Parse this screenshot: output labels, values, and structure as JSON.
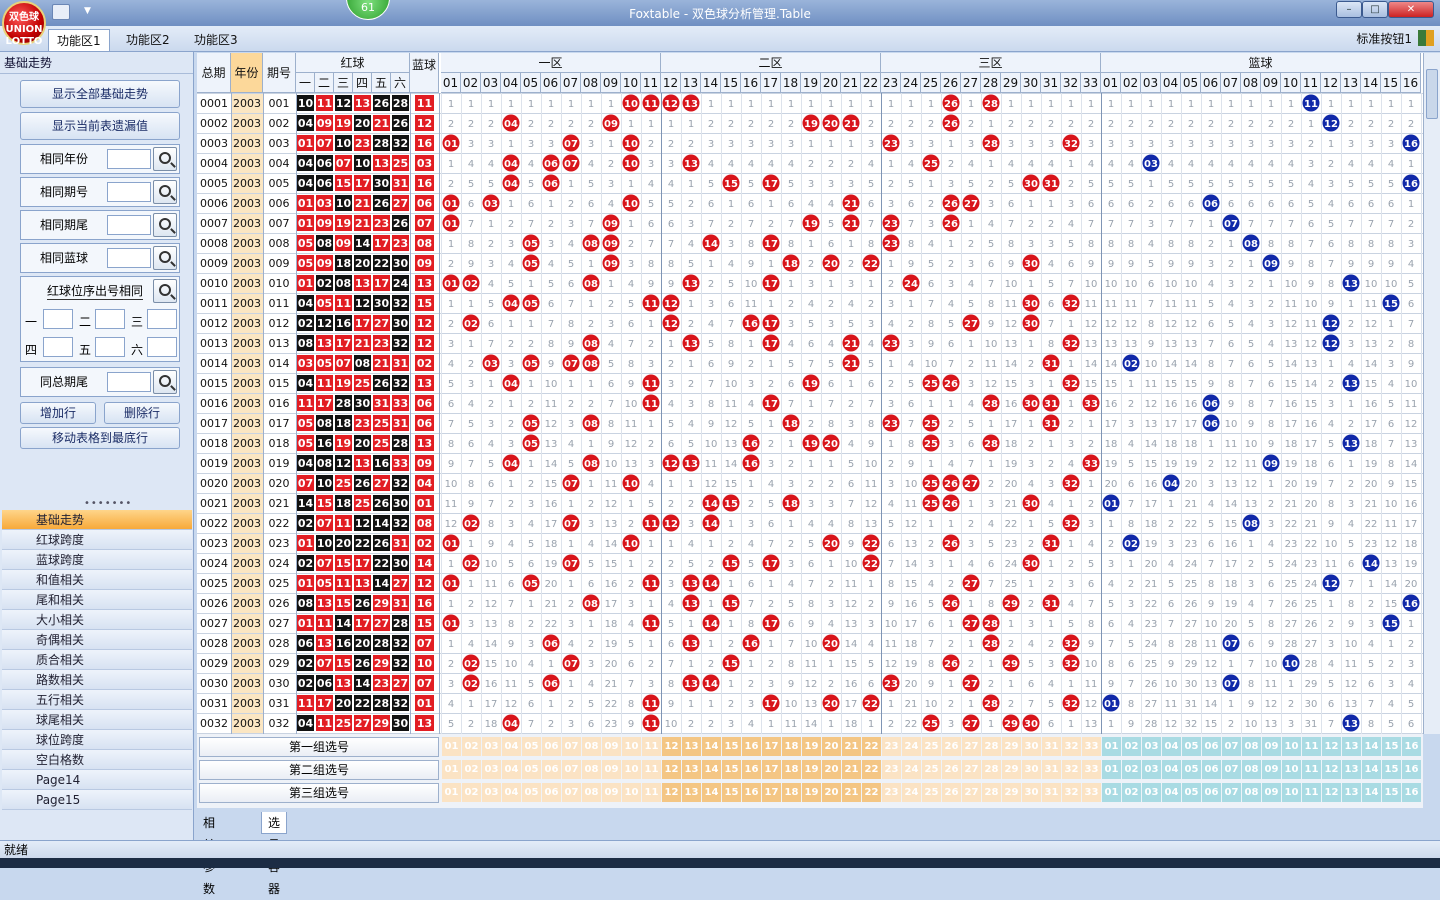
{
  "window": {
    "title": "Foxtable - 双色球分析管理.Table",
    "logo_text": "双色球\nUNION\nLOTTO",
    "counter": "61",
    "btn_min": "–",
    "btn_max": "□",
    "btn_close": "✕"
  },
  "menu": {
    "tabs": [
      "功能区1",
      "功能区2",
      "功能区3"
    ],
    "active": 0,
    "right_button": "标准按钮1"
  },
  "left": {
    "header": "基础走势",
    "show_all": "显示全部基础走势",
    "show_omit": "显示当前表遗漏值",
    "filters": [
      "相同年份",
      "相同期号",
      "相同期尾",
      "相同蓝球"
    ],
    "position_match": "红球位序出号相同",
    "positions": [
      "一",
      "二",
      "三",
      "四",
      "五",
      "六"
    ],
    "same_total": "同总期尾",
    "add_row": "增加行",
    "delete_row": "删除行",
    "move_table": "移动表格到最底行",
    "nav": [
      "基础走势",
      "红球跨度",
      "蓝球跨度",
      "和值相关",
      "尾和相关",
      "大小相关",
      "奇偶相关",
      "质合相关",
      "路数相关",
      "五行相关",
      "球尾相关",
      "球位跨度",
      "空白格数",
      "Page14",
      "Page15"
    ],
    "nav_active": 0
  },
  "grid": {
    "headers": {
      "total": "总期",
      "year": "年份",
      "issue": "期号",
      "red": "红球",
      "blue": "蓝球",
      "zone1": "一区",
      "zone2": "二区",
      "zone3": "三区",
      "zoneb": "篮球"
    },
    "red_pos": [
      "一",
      "二",
      "三",
      "四",
      "五",
      "六"
    ],
    "rows": [
      {
        "total": "0001",
        "year": "2003",
        "issue": "001",
        "red": [
          10,
          11,
          12,
          13,
          26,
          28
        ],
        "blue": 11
      },
      {
        "total": "0002",
        "year": "2003",
        "issue": "002",
        "red": [
          4,
          9,
          19,
          20,
          21,
          26
        ],
        "blue": 12
      },
      {
        "total": "0003",
        "year": "2003",
        "issue": "003",
        "red": [
          1,
          7,
          10,
          23,
          28,
          32
        ],
        "blue": 16
      },
      {
        "total": "0004",
        "year": "2003",
        "issue": "004",
        "red": [
          4,
          6,
          7,
          10,
          13,
          25
        ],
        "blue": 3
      },
      {
        "total": "0005",
        "year": "2003",
        "issue": "005",
        "red": [
          4,
          6,
          15,
          17,
          30,
          31
        ],
        "blue": 16
      },
      {
        "total": "0006",
        "year": "2003",
        "issue": "006",
        "red": [
          1,
          3,
          10,
          21,
          26,
          27
        ],
        "blue": 6
      },
      {
        "total": "0007",
        "year": "2003",
        "issue": "007",
        "red": [
          1,
          9,
          19,
          21,
          23,
          26
        ],
        "blue": 7
      },
      {
        "total": "0008",
        "year": "2003",
        "issue": "008",
        "red": [
          5,
          8,
          9,
          14,
          17,
          23
        ],
        "blue": 8
      },
      {
        "total": "0009",
        "year": "2003",
        "issue": "009",
        "red": [
          5,
          9,
          18,
          20,
          22,
          30
        ],
        "blue": 9
      },
      {
        "total": "0010",
        "year": "2003",
        "issue": "010",
        "red": [
          1,
          2,
          8,
          13,
          17,
          24
        ],
        "blue": 13
      },
      {
        "total": "0011",
        "year": "2003",
        "issue": "011",
        "red": [
          4,
          5,
          11,
          12,
          30,
          32
        ],
        "blue": 15
      },
      {
        "total": "0012",
        "year": "2003",
        "issue": "012",
        "red": [
          2,
          12,
          16,
          17,
          27,
          30
        ],
        "blue": 12
      },
      {
        "total": "0013",
        "year": "2003",
        "issue": "013",
        "red": [
          8,
          13,
          17,
          21,
          23,
          32
        ],
        "blue": 12
      },
      {
        "total": "0014",
        "year": "2003",
        "issue": "014",
        "red": [
          3,
          5,
          7,
          8,
          21,
          31
        ],
        "blue": 2
      },
      {
        "total": "0015",
        "year": "2003",
        "issue": "015",
        "red": [
          4,
          11,
          19,
          25,
          26,
          32
        ],
        "blue": 13
      },
      {
        "total": "0016",
        "year": "2003",
        "issue": "016",
        "red": [
          11,
          17,
          28,
          30,
          31,
          33
        ],
        "blue": 6
      },
      {
        "total": "0017",
        "year": "2003",
        "issue": "017",
        "red": [
          5,
          8,
          18,
          23,
          25,
          31
        ],
        "blue": 6
      },
      {
        "total": "0018",
        "year": "2003",
        "issue": "018",
        "red": [
          5,
          16,
          19,
          20,
          25,
          28
        ],
        "blue": 13
      },
      {
        "total": "0019",
        "year": "2003",
        "issue": "019",
        "red": [
          4,
          8,
          12,
          13,
          16,
          33
        ],
        "blue": 9
      },
      {
        "total": "0020",
        "year": "2003",
        "issue": "020",
        "red": [
          7,
          10,
          25,
          26,
          27,
          32
        ],
        "blue": 4
      },
      {
        "total": "0021",
        "year": "2003",
        "issue": "021",
        "red": [
          14,
          15,
          18,
          25,
          26,
          30
        ],
        "blue": 1
      },
      {
        "total": "0022",
        "year": "2003",
        "issue": "022",
        "red": [
          2,
          7,
          11,
          12,
          14,
          32
        ],
        "blue": 8
      },
      {
        "total": "0023",
        "year": "2003",
        "issue": "023",
        "red": [
          1,
          10,
          20,
          22,
          26,
          31
        ],
        "blue": 2
      },
      {
        "total": "0024",
        "year": "2003",
        "issue": "024",
        "red": [
          2,
          7,
          15,
          17,
          22,
          30
        ],
        "blue": 14
      },
      {
        "total": "0025",
        "year": "2003",
        "issue": "025",
        "red": [
          1,
          5,
          11,
          13,
          14,
          27
        ],
        "blue": 12
      },
      {
        "total": "0026",
        "year": "2003",
        "issue": "026",
        "red": [
          8,
          13,
          15,
          26,
          29,
          31
        ],
        "blue": 16
      },
      {
        "total": "0027",
        "year": "2003",
        "issue": "027",
        "red": [
          1,
          11,
          14,
          17,
          27,
          28
        ],
        "blue": 15
      },
      {
        "total": "0028",
        "year": "2003",
        "issue": "028",
        "red": [
          6,
          13,
          16,
          20,
          28,
          32
        ],
        "blue": 7
      },
      {
        "total": "0029",
        "year": "2003",
        "issue": "029",
        "red": [
          2,
          7,
          15,
          26,
          29,
          32
        ],
        "blue": 10
      },
      {
        "total": "0030",
        "year": "2003",
        "issue": "030",
        "red": [
          2,
          6,
          13,
          14,
          23,
          27
        ],
        "blue": 7
      },
      {
        "total": "0031",
        "year": "2003",
        "issue": "031",
        "red": [
          11,
          17,
          20,
          22,
          28,
          32
        ],
        "blue": 1
      },
      {
        "total": "0032",
        "year": "2003",
        "issue": "032",
        "red": [
          4,
          11,
          25,
          27,
          29,
          30
        ],
        "blue": 13
      }
    ]
  },
  "groups": [
    "第一组选号",
    "第二组选号",
    "第三组选号"
  ],
  "bottom_tabs": [
    "相关参数",
    "选号容器"
  ],
  "bottom_active": 1,
  "status": "就绪",
  "colors": {
    "red_ball": "#d8141b",
    "blue_ball": "#1028a8",
    "group_zone1": "#fbe3c4",
    "group_zone2": "#f4c684",
    "group_blue": "#a9dbe3"
  }
}
